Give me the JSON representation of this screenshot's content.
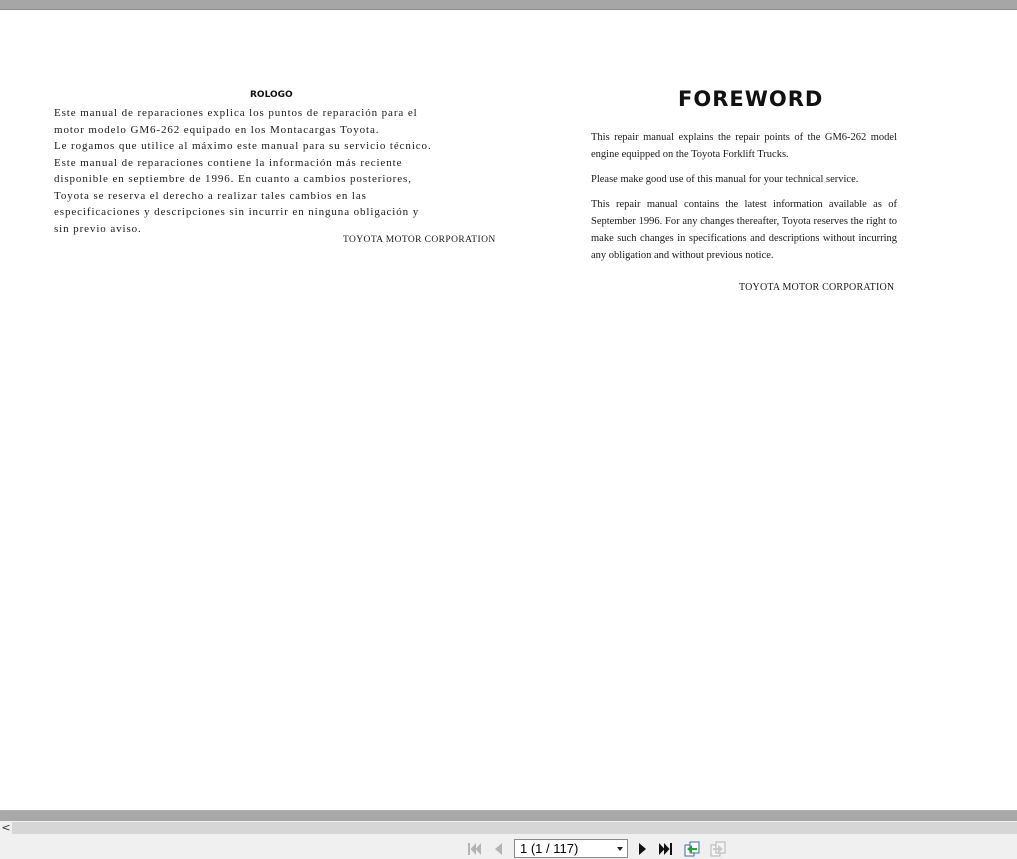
{
  "document": {
    "spanish": {
      "title": "ROLOGO",
      "lines": [
        "Este manual de reparaciones explica los puntos de reparación para el",
        "motor modelo GM6-262 equipado en los Montacargas Toyota.",
        "Le rogamos que utilice al máximo este manual para su servicio técnico.",
        "Este manual de reparaciones contiene la información más reciente",
        "disponible en septiembre de 1996. En cuanto a cambios posteriores,",
        "Toyota se reserva el derecho a realizar tales cambios en las",
        "especificaciones y descripciones sin incurrir en ninguna obligación y",
        "sin previo aviso."
      ],
      "signature": "TOYOTA MOTOR CORPORATION"
    },
    "english": {
      "title": "FOREWORD",
      "paragraphs": [
        "This repair manual explains the repair points of the GM6-262 model engine equipped on the Toyota Forklift Trucks.",
        "Please make good use of this manual for your technical service.",
        "This repair manual contains the latest information available as of September 1996. For any changes thereafter, Toyota reserves the right to make such changes in specifications and descriptions without incurring any obligation and without previous notice."
      ],
      "signature": "TOYOTA MOTOR CORPORATION"
    }
  },
  "scrollbar": {
    "left_arrow": "<"
  },
  "navigation": {
    "page_indicator": "1 (1 / 117)",
    "icons": {
      "first": "first-page-icon",
      "prev": "previous-page-icon",
      "next": "next-page-icon",
      "last": "last-page-icon",
      "back": "go-back-icon",
      "forward": "go-forward-icon"
    },
    "colors": {
      "active": "#111111",
      "disabled": "#b4b4b4"
    }
  }
}
